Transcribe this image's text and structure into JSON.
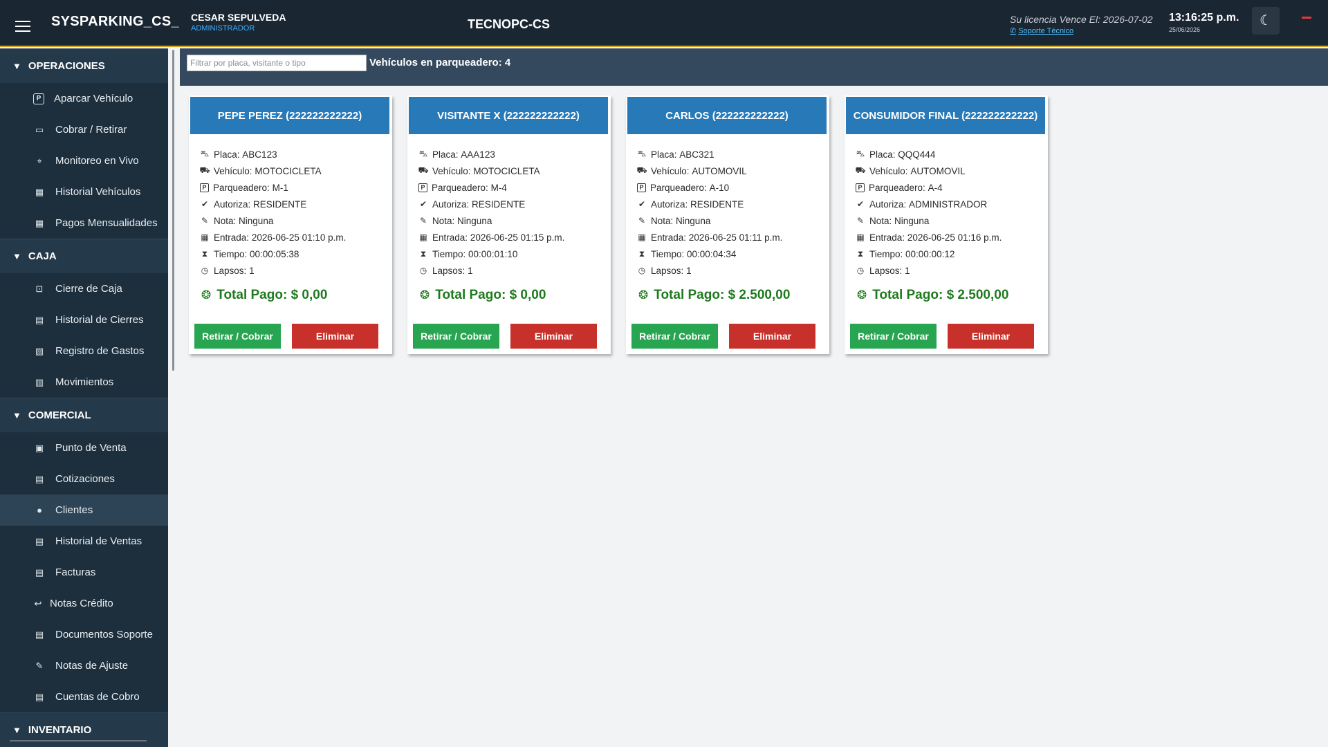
{
  "app": {
    "title": "SYSPARKING_CS_",
    "user_name": "CESAR SEPULVEDA",
    "user_role": "ADMINISTRADOR",
    "center_title": "TECNOPC-CS",
    "license_text": "Su licencia Vence El: 2026-07-02",
    "support_label": "Soporte Técnico",
    "clock": "13:16:25 p.m.",
    "date": "25/06/2026",
    "accent_color": "#d8a21b"
  },
  "sidebar": {
    "sections": [
      {
        "label": "OPERACIONES",
        "items": [
          {
            "label": "Aparcar Vehículo",
            "icon": "parking-icon"
          },
          {
            "label": "Cobrar / Retirar",
            "icon": "card-icon"
          },
          {
            "label": "Monitoreo en Vivo",
            "icon": "satellite-icon"
          },
          {
            "label": "Historial Vehículos",
            "icon": "calendar-icon"
          },
          {
            "label": "Pagos Mensualidades",
            "icon": "calendar-icon"
          }
        ]
      },
      {
        "label": "CAJA",
        "items": [
          {
            "label": "Cierre de Caja",
            "icon": "lock-icon"
          },
          {
            "label": "Historial de Cierres",
            "icon": "book-icon"
          },
          {
            "label": "Registro de Gastos",
            "icon": "receipt-icon"
          },
          {
            "label": "Movimientos",
            "icon": "chart-icon"
          }
        ]
      },
      {
        "label": "COMERCIAL",
        "items": [
          {
            "label": "Punto de Venta",
            "icon": "register-icon"
          },
          {
            "label": "Cotizaciones",
            "icon": "document-icon"
          },
          {
            "label": "Clientes",
            "icon": "user-icon"
          },
          {
            "label": "Historial de Ventas",
            "icon": "document-icon"
          },
          {
            "label": "Facturas",
            "icon": "invoice-icon"
          },
          {
            "label": "Notas Crédito",
            "icon": "return-icon"
          },
          {
            "label": "Documentos Soporte",
            "icon": "document-icon"
          },
          {
            "label": "Notas de Ajuste",
            "icon": "edit-document-icon"
          },
          {
            "label": "Cuentas de Cobro",
            "icon": "document-icon"
          }
        ]
      },
      {
        "label": "INVENTARIO",
        "items": []
      }
    ],
    "active_item": "Clientes"
  },
  "filter": {
    "placeholder": "Filtrar por placa, visitante o tipo",
    "value": "",
    "count_label": "Vehículos en parqueadero: 4"
  },
  "labels": {
    "placa": "Placa:",
    "vehiculo": "Vehículo:",
    "parqueadero": "Parqueadero:",
    "autoriza": "Autoriza:",
    "nota": "Nota:",
    "entrada": "Entrada:",
    "tiempo": "Tiempo:",
    "lapsos": "Lapsos:",
    "total": "Total Pago:",
    "btn_retirar": "Retirar / Cobrar",
    "btn_eliminar": "Eliminar"
  },
  "cards": [
    {
      "title": "PEPE PEREZ (222222222222)",
      "placa": "ABC123",
      "vehiculo": "MOTOCICLETA",
      "parqueadero": "M-1",
      "autoriza": "RESIDENTE",
      "nota": "Ninguna",
      "entrada": "2026-06-25 01:10 p.m.",
      "tiempo": "00:00:05:38",
      "lapsos": "1",
      "total": "$ 0,00"
    },
    {
      "title": "VISITANTE X (222222222222)",
      "placa": "AAA123",
      "vehiculo": "MOTOCICLETA",
      "parqueadero": "M-4",
      "autoriza": "RESIDENTE",
      "nota": "Ninguna",
      "entrada": "2026-06-25 01:15 p.m.",
      "tiempo": "00:00:01:10",
      "lapsos": "1",
      "total": "$ 0,00"
    },
    {
      "title": "CARLOS (222222222222)",
      "placa": "ABC321",
      "vehiculo": "AUTOMOVIL",
      "parqueadero": "A-10",
      "autoriza": "RESIDENTE",
      "nota": "Ninguna",
      "entrada": "2026-06-25 01:11 p.m.",
      "tiempo": "00:00:04:34",
      "lapsos": "1",
      "total": "$ 2.500,00"
    },
    {
      "title": "CONSUMIDOR FINAL (222222222222)",
      "placa": "QQQ444",
      "vehiculo": "AUTOMOVIL",
      "parqueadero": "A-4",
      "autoriza": "ADMINISTRADOR",
      "nota": "Ninguna",
      "entrada": "2026-06-25 01:16 p.m.",
      "tiempo": "00:00:00:12",
      "lapsos": "1",
      "total": "$ 2.500,00"
    }
  ]
}
